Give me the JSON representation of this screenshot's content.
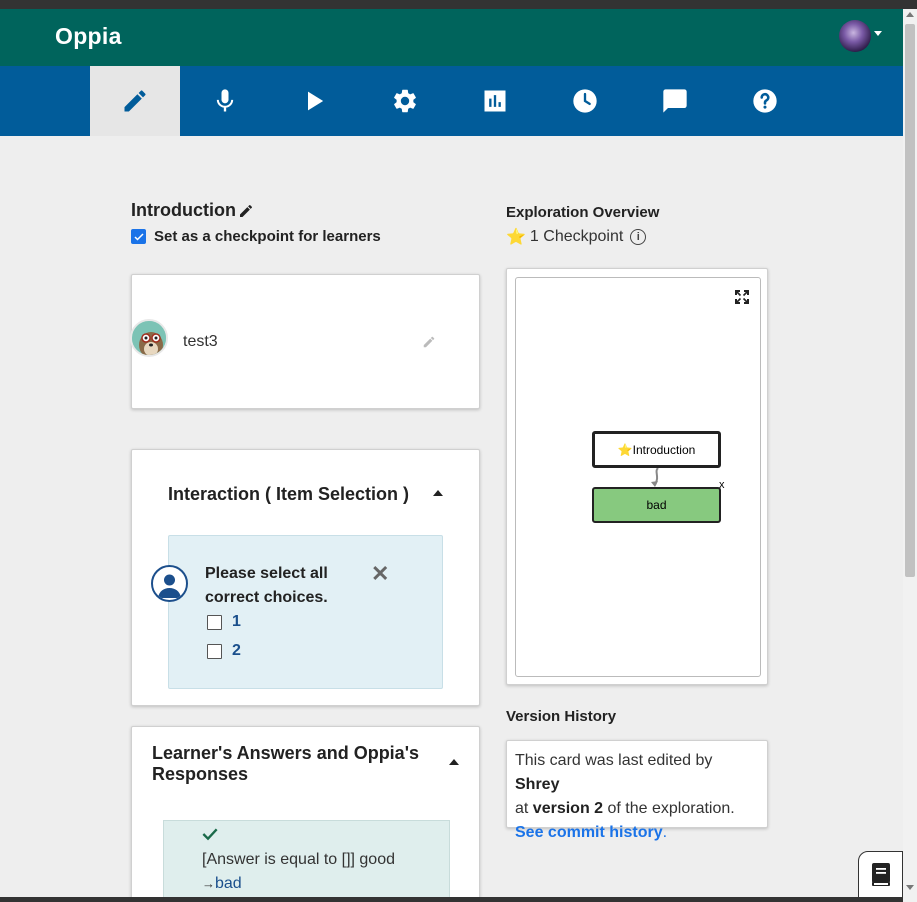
{
  "header": {
    "logo": "Oppia",
    "icons": [
      "user-avatar"
    ],
    "colors": {
      "header": "#00645c",
      "tabbar": "#015c9a",
      "accent": "#1a73e8"
    }
  },
  "tabs": [
    {
      "name": "edit",
      "icon": "pencil-icon",
      "active": true
    },
    {
      "name": "translate",
      "icon": "microphone-icon",
      "active": false
    },
    {
      "name": "preview",
      "icon": "play-icon",
      "active": false
    },
    {
      "name": "settings",
      "icon": "gear-icon",
      "active": false
    },
    {
      "name": "stats",
      "icon": "bar-chart-icon",
      "active": false
    },
    {
      "name": "history",
      "icon": "clock-icon",
      "active": false
    },
    {
      "name": "feedback",
      "icon": "chat-icon",
      "active": false
    },
    {
      "name": "help",
      "icon": "help-icon",
      "active": false
    }
  ],
  "state": {
    "title": "Introduction",
    "checkpoint_label": "Set as a checkpoint for learners",
    "checkpoint_checked": true
  },
  "content": {
    "text": "test3"
  },
  "interaction": {
    "title": "Interaction ( Item Selection )",
    "question": "Please select all correct choices.",
    "choices": [
      "1",
      "2"
    ]
  },
  "responses": {
    "title": "Learner's Answers and Oppia's Responses",
    "answer_rule": "[Answer is equal to []] good",
    "arrow": "→",
    "destination": "bad"
  },
  "overview": {
    "title": "Exploration Overview",
    "checkpoint_star": "⭐",
    "checkpoint_count": "1 Checkpoint",
    "info_icon": "i",
    "nodes": [
      {
        "label": "⭐Introduction",
        "color": "#ffffff"
      },
      {
        "label": "bad",
        "color": "#87c97f"
      }
    ],
    "close_mark": "x"
  },
  "version_history": {
    "title": "Version History",
    "prefix": "This card was last edited by ",
    "editor": "Shrey",
    "middle_at": "at ",
    "version": "version 2",
    "suffix": " of the exploration.",
    "link": "See commit history",
    "period": "."
  }
}
